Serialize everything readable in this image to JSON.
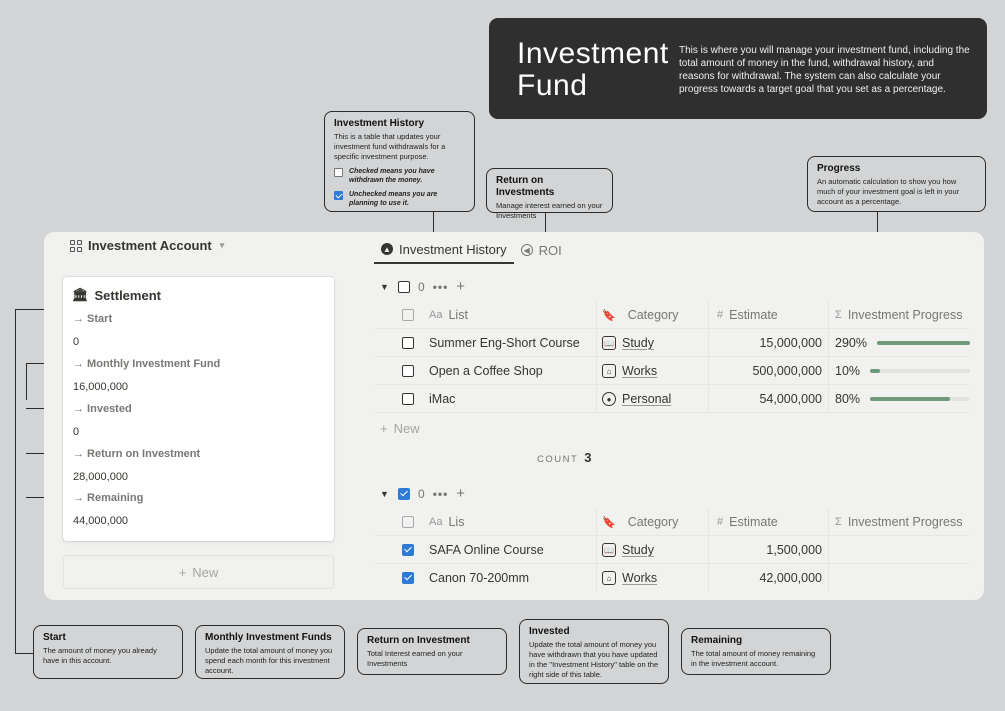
{
  "hero": {
    "title": "Investment Fund",
    "description": "This is where you will manage your investment fund, including the total amount of money in the fund, withdrawal history, and reasons for withdrawal. The system can also calculate your progress towards a target goal that you set as a percentage."
  },
  "callouts": {
    "history": {
      "title": "Investment History",
      "body": "This is a table that updates your investment fund withdrawals for a specific investment purpose.",
      "checked": "Checked means you have withdrawn the money.",
      "unchecked": "Unchecked means you are planning to use it."
    },
    "roi": {
      "title": "Return on Investments",
      "body": "Manage interest earned on your Investments"
    },
    "progress": {
      "title": "Progress",
      "body": "An automatic calculation to show you how much of your investment goal is left in your account as a percentage."
    },
    "start": {
      "title": "Start",
      "body": "The amount of money you already have in this account."
    },
    "monthly": {
      "title": "Monthly Investment Funds",
      "body": "Update the total amount of money you spend each month for this investment account."
    },
    "return": {
      "title": "Return on Investment",
      "body": "Total Interest earned on your Investments"
    },
    "invested": {
      "title": "Invested",
      "body": "Update the total amount of money you have withdrawn that you have updated in the \"Investment History\" table on the right side of this table."
    },
    "remaining": {
      "title": "Remaining",
      "body": "The total amount of money remaining in the investment account."
    }
  },
  "account": {
    "title": "Investment Account",
    "card_title": "Settlement",
    "props": [
      {
        "label": "→ Start",
        "value": "0"
      },
      {
        "label": "→ Monthly Investment Fund",
        "value": "16,000,000"
      },
      {
        "label": "→ Invested",
        "value": "0"
      },
      {
        "label": "→ Return on Investment",
        "value": "28,000,000"
      },
      {
        "label": "→ Remaining",
        "value": "44,000,000"
      }
    ],
    "new_label": "New"
  },
  "tabs": [
    {
      "label": "Investment History"
    },
    {
      "label": "ROI"
    }
  ],
  "table": {
    "headers": {
      "list": "List",
      "list_short": "Lis",
      "category": "Category",
      "estimate": "Estimate",
      "progress": "Investment Progress"
    },
    "group1": {
      "count": "0",
      "rows": [
        {
          "name": "Summer Eng-Short Course",
          "category": "Study",
          "estimate": "15,000,000",
          "progress": "290%",
          "progress_value": 1.0
        },
        {
          "name": "Open a Coffee Shop",
          "category": "Works",
          "estimate": "500,000,000",
          "progress": "10%",
          "progress_value": 0.1
        },
        {
          "name": "iMac",
          "category": "Personal",
          "estimate": "54,000,000",
          "progress": "80%",
          "progress_value": 0.8
        }
      ],
      "new_label": "New",
      "count_label": "COUNT",
      "count_value": "3"
    },
    "group2": {
      "count": "0",
      "rows": [
        {
          "name": "SAFA Online Course",
          "category": "Study",
          "estimate": "1,500,000"
        },
        {
          "name": "Canon 70-200mm",
          "category": "Works",
          "estimate": "42,000,000"
        }
      ]
    }
  },
  "colors": {
    "accent": "#2e7bd6",
    "progress": "#6c9a7b",
    "hero_bg": "#2f2f2f"
  }
}
